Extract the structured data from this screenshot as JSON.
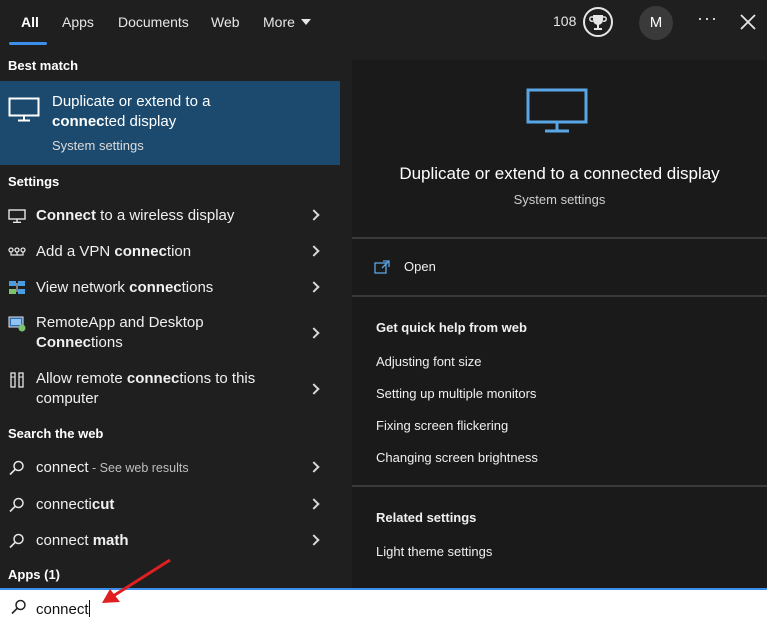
{
  "tabs": [
    {
      "label": "All",
      "active": true
    },
    {
      "label": "Apps"
    },
    {
      "label": "Documents"
    },
    {
      "label": "Web"
    },
    {
      "label": "More"
    }
  ],
  "header": {
    "points": "108",
    "avatar_initial": "M",
    "more_options": "···"
  },
  "left": {
    "best_match_heading": "Best match",
    "best_match": {
      "line1": "Duplicate or extend to a",
      "line2_bold": "connec",
      "line2_rest": "ted display",
      "subtitle": "System settings"
    },
    "settings_heading": "Settings",
    "settings_items": [
      {
        "bold": "Connect",
        "rest": " to a wireless display"
      },
      {
        "pre": "Add a VPN ",
        "bold": "connec",
        "rest": "tion"
      },
      {
        "pre": "View network ",
        "bold": "connec",
        "rest": "tions"
      },
      {
        "line1": "RemoteApp and Desktop",
        "bold": "Connec",
        "rest": "tions"
      },
      {
        "pre": "Allow remote ",
        "bold": "connec",
        "rest": "tions to this",
        "line2": "computer"
      }
    ],
    "web_heading": "Search the web",
    "web_items": [
      {
        "text": "connect",
        "suffix": " - See web results"
      },
      {
        "text": "connecti",
        "bold": "cut"
      },
      {
        "text": "connect ",
        "bold": "math"
      }
    ],
    "apps_heading": "Apps (1)"
  },
  "right": {
    "title": "Duplicate or extend to a connected display",
    "subtitle": "System settings",
    "open_label": "Open",
    "help_heading": "Get quick help from web",
    "help_links": [
      "Adjusting font size",
      "Setting up multiple monitors",
      "Fixing screen flickering",
      "Changing screen brightness"
    ],
    "related_heading": "Related settings",
    "related_links": [
      "Light theme settings"
    ]
  },
  "search": {
    "value": "connect",
    "icon": "search-icon"
  },
  "colors": {
    "accent": "#3b8eea",
    "selected_bg": "#1b4a6e",
    "pane_bg": "#1f1f1f",
    "annotation_arrow": "#e02020"
  }
}
